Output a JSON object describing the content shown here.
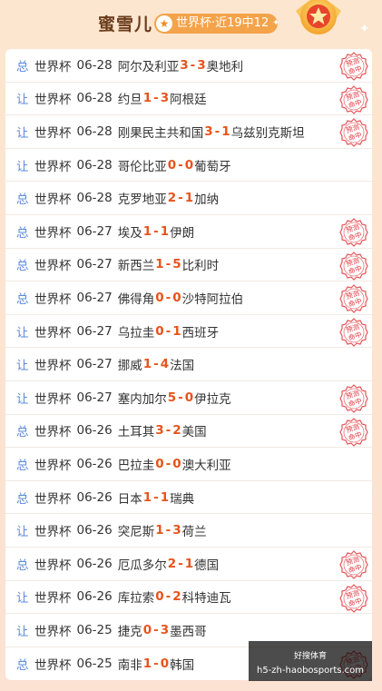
{
  "header": {
    "title": "蜜雪儿",
    "badge_text": "世界杯·近19中12",
    "star_glyph": "★",
    "accent_color": "#f3a34a",
    "score_color": "#e8531a",
    "type_color": "#5a8bd8"
  },
  "stamp": {
    "line1": "预测",
    "line2": "命中",
    "color": "#e0383e"
  },
  "matches": [
    {
      "type": "总",
      "league": "世界杯",
      "date": "06-28",
      "home": "阿尔及利亚",
      "hs": "3",
      "sep": " - ",
      "as": "3",
      "away": "奥地利",
      "hit": true
    },
    {
      "type": "让",
      "league": "世界杯",
      "date": "06-28",
      "home": "约旦",
      "hs": "1",
      "sep": " - ",
      "as": "3",
      "away": "阿根廷",
      "hit": true
    },
    {
      "type": "让",
      "league": "世界杯",
      "date": "06-28",
      "home": "刚果民主共和国",
      "hs": "3",
      "sep": " - ",
      "as": "1",
      "away": "乌兹别克斯坦",
      "hit": true
    },
    {
      "type": "让",
      "league": "世界杯",
      "date": "06-28",
      "home": "哥伦比亚",
      "hs": "0",
      "sep": " - ",
      "as": "0",
      "away": "葡萄牙",
      "hit": false
    },
    {
      "type": "总",
      "league": "世界杯",
      "date": "06-28",
      "home": "克罗地亚",
      "hs": "2",
      "sep": " - ",
      "as": "1",
      "away": "加纳",
      "hit": false
    },
    {
      "type": "总",
      "league": "世界杯",
      "date": "06-27",
      "home": "埃及",
      "hs": "1",
      "sep": " - ",
      "as": "1",
      "away": "伊朗",
      "hit": true
    },
    {
      "type": "总",
      "league": "世界杯",
      "date": "06-27",
      "home": "新西兰",
      "hs": "1",
      "sep": " - ",
      "as": "5",
      "away": "比利时",
      "hit": true
    },
    {
      "type": "总",
      "league": "世界杯",
      "date": "06-27",
      "home": "佛得角",
      "hs": "0",
      "sep": " - ",
      "as": "0",
      "away": "沙特阿拉伯",
      "hit": true
    },
    {
      "type": "让",
      "league": "世界杯",
      "date": "06-27",
      "home": "乌拉圭",
      "hs": "0",
      "sep": " - ",
      "as": "1",
      "away": "西班牙",
      "hit": true
    },
    {
      "type": "让",
      "league": "世界杯",
      "date": "06-27",
      "home": "挪威",
      "hs": "1",
      "sep": " - ",
      "as": "4",
      "away": "法国",
      "hit": false
    },
    {
      "type": "让",
      "league": "世界杯",
      "date": "06-27",
      "home": "塞内加尔",
      "hs": "5",
      "sep": " - ",
      "as": "0",
      "away": "伊拉克",
      "hit": true
    },
    {
      "type": "总",
      "league": "世界杯",
      "date": "06-26",
      "home": "土耳其",
      "hs": "3",
      "sep": " - ",
      "as": "2",
      "away": "美国",
      "hit": true
    },
    {
      "type": "总",
      "league": "世界杯",
      "date": "06-26",
      "home": "巴拉圭",
      "hs": "0",
      "sep": " - ",
      "as": "0",
      "away": "澳大利亚",
      "hit": false
    },
    {
      "type": "总",
      "league": "世界杯",
      "date": "06-26",
      "home": "日本",
      "hs": "1",
      "sep": " - ",
      "as": "1",
      "away": "瑞典",
      "hit": false
    },
    {
      "type": "让",
      "league": "世界杯",
      "date": "06-26",
      "home": "突尼斯",
      "hs": "1",
      "sep": " - ",
      "as": "3",
      "away": "荷兰",
      "hit": false
    },
    {
      "type": "总",
      "league": "世界杯",
      "date": "06-26",
      "home": "厄瓜多尔",
      "hs": "2",
      "sep": " - ",
      "as": "1",
      "away": "德国",
      "hit": true
    },
    {
      "type": "让",
      "league": "世界杯",
      "date": "06-26",
      "home": "库拉索",
      "hs": "0",
      "sep": " - ",
      "as": "2",
      "away": "科特迪瓦",
      "hit": true
    },
    {
      "type": "让",
      "league": "世界杯",
      "date": "06-25",
      "home": "捷克",
      "hs": "0",
      "sep": " - ",
      "as": "3",
      "away": "墨西哥",
      "hit": false
    },
    {
      "type": "总",
      "league": "世界杯",
      "date": "06-25",
      "home": "南非",
      "hs": "1",
      "sep": " - ",
      "as": "0",
      "away": "韩国",
      "hit": true
    }
  ],
  "watermark": {
    "line1": "好搜体育",
    "line2": "h5-zh-haobosports.com"
  }
}
